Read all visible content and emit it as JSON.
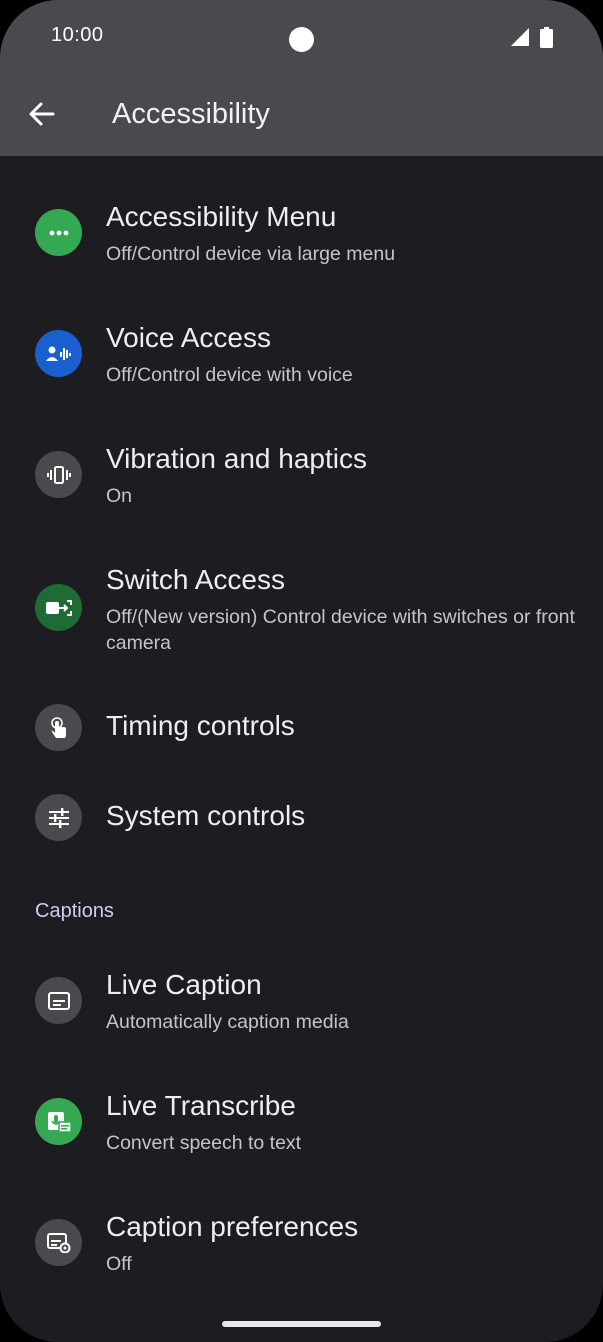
{
  "status_bar": {
    "time": "10:00"
  },
  "header": {
    "title": "Accessibility"
  },
  "items": [
    {
      "title": "Accessibility Menu",
      "subtitle": "Off/Control device via large menu",
      "icon": "accessibility-menu-icon"
    },
    {
      "title": "Voice Access",
      "subtitle": "Off/Control device with voice",
      "icon": "voice-access-icon"
    },
    {
      "title": "Vibration and haptics",
      "subtitle": "On",
      "icon": "vibration-icon"
    },
    {
      "title": "Switch Access",
      "subtitle": "Off/(New version) Control device with switches or front camera",
      "icon": "switch-access-icon"
    },
    {
      "title": "Timing controls",
      "icon": "touch-hand-icon"
    },
    {
      "title": "System controls",
      "icon": "sliders-icon"
    }
  ],
  "captions": {
    "section_title": "Captions",
    "items": [
      {
        "title": "Live Caption",
        "subtitle": "Automatically caption media",
        "icon": "caption-icon"
      },
      {
        "title": "Live Transcribe",
        "subtitle": "Convert speech to text",
        "icon": "live-transcribe-icon"
      },
      {
        "title": "Caption preferences",
        "subtitle": "Off",
        "icon": "caption-settings-icon"
      }
    ]
  },
  "colors": {
    "background": "#1d1c21",
    "topbar": "#4a494e",
    "green": "#34a853",
    "blue": "#1a5fd0",
    "dark_green": "#1f6b35",
    "gray_icon": "#4a494e",
    "section_label": "#d7c8f5"
  }
}
